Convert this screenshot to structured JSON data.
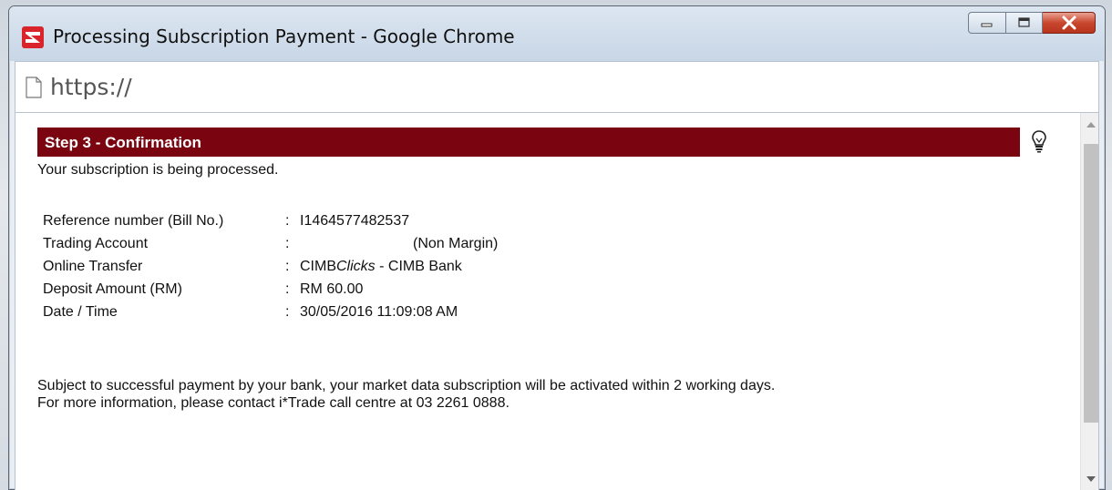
{
  "window": {
    "title": "Processing Subscription Payment - Google Chrome"
  },
  "address_bar": {
    "url": "https://"
  },
  "page": {
    "step_header": "Step 3 - Confirmation",
    "status_message": "Your subscription is being processed.",
    "details": [
      {
        "label": "Reference number (Bill No.)",
        "separator": ":",
        "value": "I1464577482537"
      },
      {
        "label": "Trading Account",
        "separator": ":",
        "value": "(Non Margin)"
      },
      {
        "label": "Online Transfer",
        "separator": ":",
        "value_prefix": "CIMB",
        "value_italic": "Clicks",
        "value_suffix": " - CIMB Bank"
      },
      {
        "label": "Deposit Amount (RM)",
        "separator": ":",
        "value": "RM 60.00"
      },
      {
        "label": "Date / Time",
        "separator": ":",
        "value": "30/05/2016 11:09:08 AM"
      }
    ],
    "note_lines": [
      "Subject to successful payment by your bank, your market data subscription will be activated within 2 working days.",
      "For more information, please contact i*Trade call centre at 03 2261 0888."
    ]
  },
  "colors": {
    "header_bg": "#7a0410",
    "close_button": "#c9472f",
    "app_icon": "#d8242a"
  },
  "icons": [
    "app-logo-icon",
    "minimize-icon",
    "maximize-icon",
    "close-icon",
    "page-icon",
    "lightbulb-icon",
    "scroll-up-icon",
    "scroll-down-icon"
  ]
}
